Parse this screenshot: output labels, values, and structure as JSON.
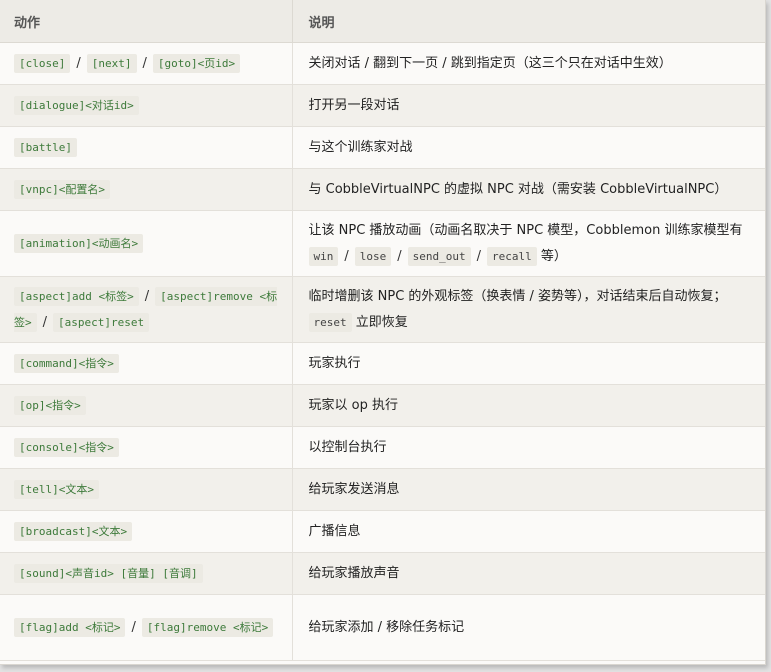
{
  "header": {
    "col_action": "动作",
    "col_desc": "说明"
  },
  "rows": [
    {
      "action": [
        "[close]",
        "/",
        "[next]",
        "/",
        "[goto]<页id>"
      ],
      "desc": "关闭对话 / 翻到下一页 / 跳到指定页（这三个只在对话中生效）"
    },
    {
      "action": [
        "[dialogue]<对话id>"
      ],
      "desc": "打开另一段对话"
    },
    {
      "action": [
        "[battle]"
      ],
      "desc": "与这个训练家对战"
    },
    {
      "action": [
        "[vnpc]<配置名>"
      ],
      "desc": "与 CobbleVirtualNPC 的虚拟 NPC 对战（需安装 CobbleVirtualNPC）"
    },
    {
      "action": [
        "[animation]<动画名>"
      ],
      "desc_parts": [
        "让该 NPC 播放动画（动画名取决于 NPC 模型，Cobblemon 训练家模型有",
        "win",
        "/",
        "lose",
        "/",
        "send_out",
        "/",
        "recall",
        "等）"
      ]
    },
    {
      "action": [
        "[aspect]add <标签>",
        "/",
        "[aspect]remove <标签>",
        "/",
        "[aspect]reset"
      ],
      "desc_parts": [
        "临时增删该 NPC 的外观标签（换表情 / 姿势等），对话结束后自动恢复；",
        "reset",
        "立即恢复"
      ]
    },
    {
      "action": [
        "[command]<指令>"
      ],
      "desc": "玩家执行"
    },
    {
      "action": [
        "[op]<指令>"
      ],
      "desc": "玩家以 op 执行"
    },
    {
      "action": [
        "[console]<指令>"
      ],
      "desc": "以控制台执行"
    },
    {
      "action": [
        "[tell]<文本>"
      ],
      "desc": "给玩家发送消息"
    },
    {
      "action": [
        "[broadcast]<文本>"
      ],
      "desc": "广播信息"
    },
    {
      "action": [
        "[sound]<声音id> [音量] [音调]"
      ],
      "desc": "给玩家播放声音"
    },
    {
      "action": [
        "[flag]add <标记>",
        "/",
        "[flag]remove <标记>"
      ],
      "desc": "给玩家添加 / 移除任务标记"
    }
  ]
}
